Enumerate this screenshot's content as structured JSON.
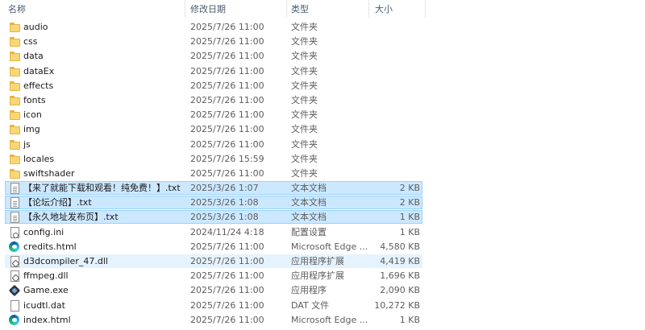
{
  "columns": {
    "name": "名称",
    "date": "修改日期",
    "type": "类型",
    "size": "大小"
  },
  "files": [
    {
      "name": "audio",
      "date": "2025/7/26 11:00",
      "type": "文件夹",
      "size": "",
      "icon": "folder-icon",
      "state": ""
    },
    {
      "name": "css",
      "date": "2025/7/26 11:00",
      "type": "文件夹",
      "size": "",
      "icon": "folder-icon",
      "state": ""
    },
    {
      "name": "data",
      "date": "2025/7/26 11:00",
      "type": "文件夹",
      "size": "",
      "icon": "folder-icon",
      "state": ""
    },
    {
      "name": "dataEx",
      "date": "2025/7/26 11:00",
      "type": "文件夹",
      "size": "",
      "icon": "folder-icon",
      "state": ""
    },
    {
      "name": "effects",
      "date": "2025/7/26 11:00",
      "type": "文件夹",
      "size": "",
      "icon": "folder-icon",
      "state": ""
    },
    {
      "name": "fonts",
      "date": "2025/7/26 11:00",
      "type": "文件夹",
      "size": "",
      "icon": "folder-icon",
      "state": ""
    },
    {
      "name": "icon",
      "date": "2025/7/26 11:00",
      "type": "文件夹",
      "size": "",
      "icon": "folder-icon",
      "state": ""
    },
    {
      "name": "img",
      "date": "2025/7/26 11:00",
      "type": "文件夹",
      "size": "",
      "icon": "folder-icon",
      "state": ""
    },
    {
      "name": "js",
      "date": "2025/7/26 11:00",
      "type": "文件夹",
      "size": "",
      "icon": "folder-icon",
      "state": ""
    },
    {
      "name": "locales",
      "date": "2025/7/26 15:59",
      "type": "文件夹",
      "size": "",
      "icon": "folder-icon",
      "state": ""
    },
    {
      "name": "swiftshader",
      "date": "2025/7/26 11:00",
      "type": "文件夹",
      "size": "",
      "icon": "folder-icon",
      "state": ""
    },
    {
      "name": "【来了就能下载和观看！纯免费！】.txt",
      "date": "2025/3/26 1:07",
      "type": "文本文档",
      "size": "2 KB",
      "icon": "text-document-icon",
      "state": "selected"
    },
    {
      "name": "【论坛介绍】.txt",
      "date": "2025/3/26 1:08",
      "type": "文本文档",
      "size": "2 KB",
      "icon": "text-document-icon",
      "state": "selected"
    },
    {
      "name": "【永久地址发布页】.txt",
      "date": "2025/3/26 1:08",
      "type": "文本文档",
      "size": "1 KB",
      "icon": "text-document-icon",
      "state": "selected"
    },
    {
      "name": "config.ini",
      "date": "2024/11/24 4:18",
      "type": "配置设置",
      "size": "1 KB",
      "icon": "settings-file-icon",
      "state": ""
    },
    {
      "name": "credits.html",
      "date": "2025/7/26 11:00",
      "type": "Microsoft Edge ...",
      "size": "4,580 KB",
      "icon": "edge-icon",
      "state": ""
    },
    {
      "name": "d3dcompiler_47.dll",
      "date": "2025/7/26 11:00",
      "type": "应用程序扩展",
      "size": "4,419 KB",
      "icon": "dll-file-icon",
      "state": "hover"
    },
    {
      "name": "ffmpeg.dll",
      "date": "2025/7/26 11:00",
      "type": "应用程序扩展",
      "size": "1,696 KB",
      "icon": "dll-file-icon",
      "state": ""
    },
    {
      "name": "Game.exe",
      "date": "2025/7/26 11:00",
      "type": "应用程序",
      "size": "2,090 KB",
      "icon": "game-exe-icon",
      "state": ""
    },
    {
      "name": "icudtl.dat",
      "date": "2025/7/26 11:00",
      "type": "DAT 文件",
      "size": "10,272 KB",
      "icon": "blank-file-icon",
      "state": ""
    },
    {
      "name": "index.html",
      "date": "2025/7/26 11:00",
      "type": "Microsoft Edge ...",
      "size": "1 KB",
      "icon": "edge-icon",
      "state": ""
    }
  ]
}
